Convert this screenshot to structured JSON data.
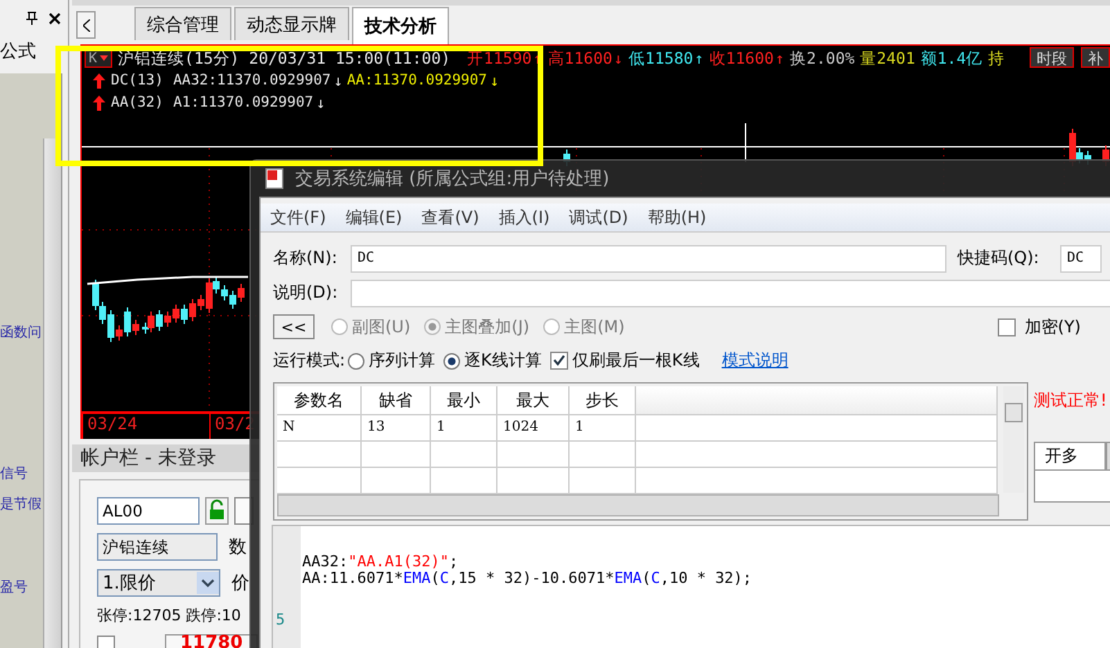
{
  "side_panel": {
    "title": "公式",
    "items": [
      "函数问",
      "信号",
      "是节假",
      "盈号"
    ]
  },
  "tabs": [
    {
      "label": "综合管理",
      "selected": false
    },
    {
      "label": "动态显示牌",
      "selected": false
    },
    {
      "label": "技术分析",
      "selected": true
    }
  ],
  "chart": {
    "period_button": "K",
    "title": "沪铝连续(15分) 20/03/31 15:00(11:00)",
    "quotes": [
      {
        "label": "开",
        "value": "11590",
        "color": "#ff2020",
        "arrow": "↑"
      },
      {
        "label": "高",
        "value": "11600",
        "color": "#ff2020",
        "arrow": "↓"
      },
      {
        "label": "低",
        "value": "11580",
        "color": "#40e8f0",
        "arrow": "↑"
      },
      {
        "label": "收",
        "value": "11600",
        "color": "#ff2020",
        "arrow": "↑"
      },
      {
        "label": "换",
        "value": "2.00%",
        "color": "#c8c8c8"
      },
      {
        "label": "量",
        "value": "2401",
        "color": "#d8d820"
      },
      {
        "label": "额",
        "value": "1.4亿",
        "color": "#40e8f0"
      },
      {
        "label": "持",
        "color": "#d8d820"
      }
    ],
    "buttons": [
      "时段",
      "补"
    ],
    "indicator_lines": [
      {
        "name": "DC(13)",
        "values": [
          {
            "text": "AA32:11370.0929907",
            "color": "#e8e8e8",
            "arrow": "↓"
          },
          {
            "text": "AA:11370.0929907",
            "color": "#f0f000",
            "arrow": "↓"
          }
        ]
      },
      {
        "name": "AA(32)",
        "values": [
          {
            "text": "A1:11370.0929907",
            "color": "#e8e8e8",
            "arrow": "↓"
          }
        ]
      }
    ],
    "dates": [
      "03/24",
      "03/2"
    ]
  },
  "account": {
    "title": "帐户栏 - 未登录",
    "code": "AL00",
    "contract": "沪铝连续",
    "quantity_label": "数",
    "order_type": "1.限价",
    "price_label": "价",
    "limits": "张停:12705 跌停:10",
    "price": "11780",
    "confirm_checked": false
  },
  "dialog": {
    "title": "交易系统编辑 (所属公式组:用户待处理)",
    "menu": [
      "文件(F)",
      "编辑(E)",
      "查看(V)",
      "插入(I)",
      "调试(D)",
      "帮助(H)"
    ],
    "name_label": "名称(N):",
    "name": "DC",
    "shortcut_label": "快捷码(Q):",
    "shortcut": "DC",
    "description_label": "说明(D):",
    "collapse_button": "<<",
    "chart_modes": [
      {
        "label": "副图(U)",
        "selected": false,
        "disabled": true
      },
      {
        "label": "主图叠加(J)",
        "selected": true,
        "disabled": true
      },
      {
        "label": "主图(M)",
        "selected": false,
        "disabled": true
      }
    ],
    "encrypt": {
      "label": "加密(Y)",
      "checked": false
    },
    "run_mode_label": "运行模式:",
    "run_modes": [
      {
        "label": "序列计算",
        "selected": false
      },
      {
        "label": "逐K线计算",
        "selected": true
      }
    ],
    "refresh_last": {
      "label": "仅刷最后一根K线",
      "checked": true
    },
    "mode_help_link": "模式说明",
    "params": {
      "columns": [
        "参数名",
        "缺省",
        "最小",
        "最大",
        "步长"
      ],
      "rows": [
        [
          "N",
          "13",
          "1",
          "1024",
          "1"
        ]
      ]
    },
    "test_status": "测试正常!",
    "side_tabs": [
      {
        "label": "开多",
        "selected": true
      }
    ],
    "code": {
      "lines": [
        [
          {
            "kind": "plain",
            "text": "AA32:"
          },
          {
            "kind": "string",
            "text": "\"AA.A1(32)\""
          },
          {
            "kind": "plain",
            "text": ";"
          }
        ],
        [
          {
            "kind": "plain",
            "text": "AA:11.6071*"
          },
          {
            "kind": "function",
            "text": "EMA"
          },
          {
            "kind": "plain",
            "text": "("
          },
          {
            "kind": "function",
            "text": "C"
          },
          {
            "kind": "plain",
            "text": ",15 * 32)-10.6071*"
          },
          {
            "kind": "function",
            "text": "EMA"
          },
          {
            "kind": "plain",
            "text": "("
          },
          {
            "kind": "function",
            "text": "C"
          },
          {
            "kind": "plain",
            "text": ",10 * 32);"
          }
        ]
      ],
      "line_number": "5"
    }
  }
}
